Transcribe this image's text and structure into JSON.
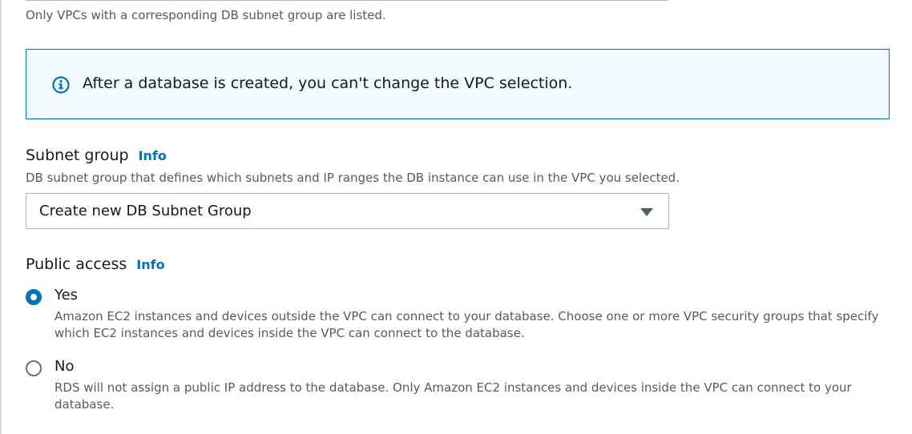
{
  "vpc": {
    "hint": "Only VPCs with a corresponding DB subnet group are listed."
  },
  "alert": {
    "icon": "info-circle-icon",
    "color": "#0073bb",
    "text": "After a database is created, you can't change the VPC selection."
  },
  "subnet_group": {
    "label": "Subnet group",
    "info": "Info",
    "description": "DB subnet group that defines which subnets and IP ranges the DB instance can use in the VPC you selected.",
    "selected": "Create new DB Subnet Group"
  },
  "public_access": {
    "label": "Public access",
    "info": "Info",
    "options": [
      {
        "title": "Yes",
        "description": "Amazon EC2 instances and devices outside the VPC can connect to your database. Choose one or more VPC security groups that specify which EC2 instances and devices inside the VPC can connect to the database.",
        "checked": true
      },
      {
        "title": "No",
        "description": "RDS will not assign a public IP address to the database. Only Amazon EC2 instances and devices inside the VPC can connect to your database.",
        "checked": false
      }
    ]
  }
}
